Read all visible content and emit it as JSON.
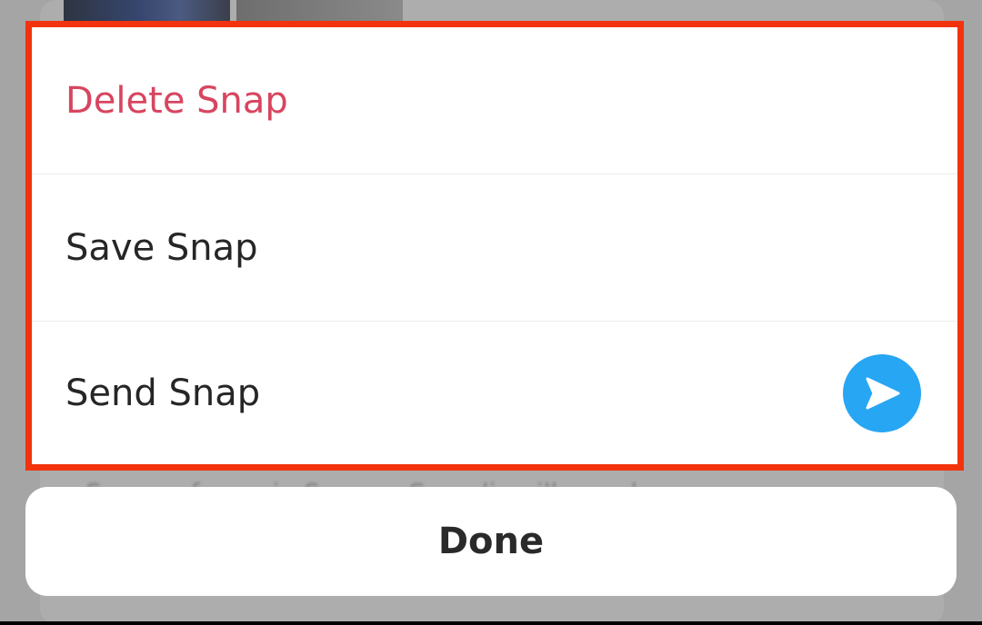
{
  "sheet": {
    "actions": [
      {
        "label": "Delete Snap",
        "color": "#d8455f"
      },
      {
        "label": "Save Snap",
        "color": "#262626"
      },
      {
        "label": "Send Snap",
        "color": "#262626",
        "icon": "send-arrow-icon",
        "icon_color": "#27a6f3"
      }
    ],
    "highlight_color": "#f2330e"
  },
  "done_label": "Done"
}
